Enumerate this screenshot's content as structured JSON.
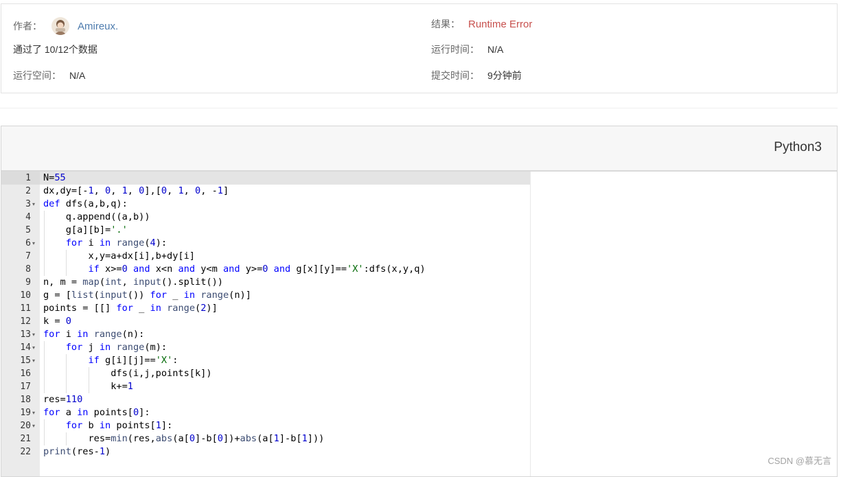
{
  "info": {
    "author_label": "作者：",
    "author_name": "Amireux.",
    "result_label": "结果：",
    "result_value": "Runtime Error",
    "passed_text": "通过了 10/12个数据",
    "run_time_label": "运行时间：",
    "run_time_value": "N/A",
    "run_space_label": "运行空间：",
    "run_space_value": "N/A",
    "submit_time_label": "提交时间：",
    "submit_time_value": "9分钟前"
  },
  "editor": {
    "language": "Python3",
    "lines": [
      "N=55",
      "dx,dy=[-1, 0, 1, 0],[0, 1, 0, -1]",
      "def dfs(a,b,q):",
      "    q.append((a,b))",
      "    g[a][b]='.'",
      "    for i in range(4):",
      "        x,y=a+dx[i],b+dy[i]",
      "        if x>=0 and x<n and y<m and y>=0 and g[x][y]=='X':dfs(x,y,q)",
      "n, m = map(int, input().split())",
      "g = [list(input()) for _ in range(n)]",
      "points = [[] for _ in range(2)]",
      "k = 0",
      "for i in range(n):",
      "    for j in range(m):",
      "        if g[i][j]=='X':",
      "            dfs(i,j,points[k])",
      "            k+=1",
      "res=110",
      "for a in points[0]:",
      "    for b in points[1]:",
      "        res=min(res,abs(a[0]-b[0])+abs(a[1]-b[1]))",
      "print(res-1)"
    ],
    "fold_lines": [
      3,
      6,
      13,
      14,
      15,
      19,
      20
    ]
  },
  "watermark": "CSDN @慕无言"
}
